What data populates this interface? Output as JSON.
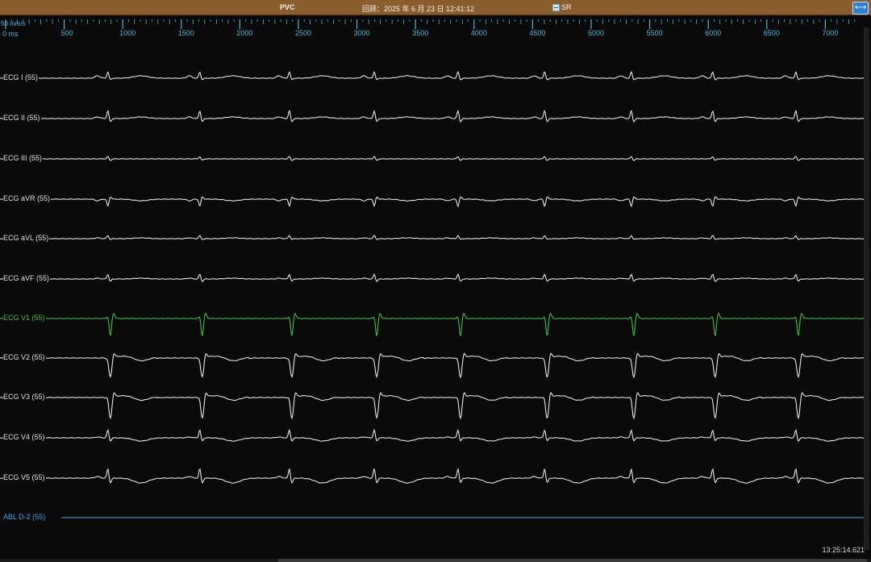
{
  "header": {
    "title": "PVC",
    "review": "回顾：2025 年 6 月 23 日 12:41:12",
    "rhythm": "SR",
    "expand_icon": "double-arrow-horizontal-icon"
  },
  "ruler": {
    "speed": "50 mm/s",
    "zero": "0 ms",
    "ticks": [
      "500",
      "1000",
      "1500",
      "2000",
      "2500",
      "3000",
      "3500",
      "4000",
      "4500",
      "5000",
      "5500",
      "6000",
      "6500",
      "7000"
    ],
    "color": "#42b9d6"
  },
  "channels": [
    {
      "label": "ECG I (55)",
      "color": "#e6e6e6"
    },
    {
      "label": "ECG II (55)",
      "color": "#e6e6e6"
    },
    {
      "label": "ECG III (55)",
      "color": "#e6e6e6"
    },
    {
      "label": "ECG aVR (55)",
      "color": "#e6e6e6"
    },
    {
      "label": "ECG aVL (55)",
      "color": "#e6e6e6"
    },
    {
      "label": "ECG aVF (55)",
      "color": "#e6e6e6"
    },
    {
      "label": "ECG V1 (55)",
      "color": "#3fbf3f"
    },
    {
      "label": "ECG V2 (55)",
      "color": "#e6e6e6"
    },
    {
      "label": "ECG V3 (55)",
      "color": "#e6e6e6"
    },
    {
      "label": "ECG V4 (55)",
      "color": "#e6e6e6"
    },
    {
      "label": "ECG V5 (55)",
      "color": "#e6e6e6"
    },
    {
      "label": "ABL D-2 (55)",
      "color": "#3fa6e6"
    }
  ],
  "beats_ms": [
    880,
    1665,
    2430,
    3155,
    3870,
    4610,
    5350,
    6045,
    6755
  ],
  "clock": "13:25:14.621"
}
